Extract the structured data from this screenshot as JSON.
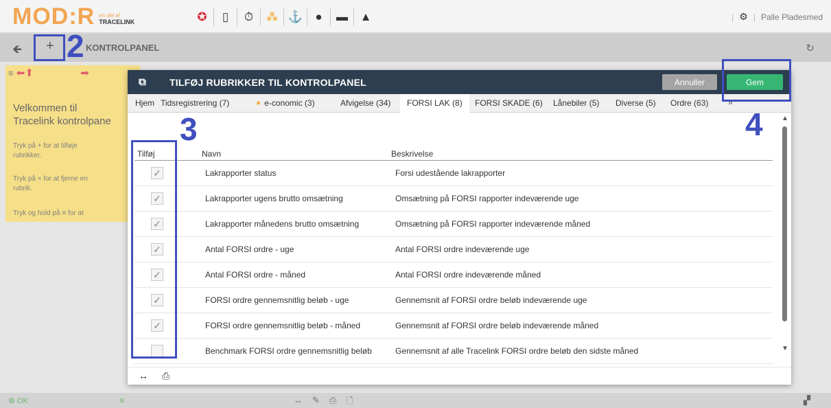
{
  "app": {
    "logo_main": "MOD:R",
    "logo_small": "en del af",
    "logo_trace": "TRACELINK",
    "user_name": "Palle Pladesmed"
  },
  "toolbar_icons": [
    "lifebuoy-icon",
    "mobile-icon",
    "timer-icon",
    "graph-icon",
    "anchor-icon",
    "chat-icon",
    "envelope-icon",
    "warning-icon"
  ],
  "nav": {
    "title": "KONTROLPANEL"
  },
  "welcome": {
    "title_line1": "Velkommen til",
    "title_line2": "Tracelink kontrolpane",
    "text1_line1": "Tryk på  +  for at tilføje",
    "text1_line2": "rubrikker.",
    "text2_line1": "Tryk på  ×  for at fjerne en",
    "text2_line2": "rubrik.",
    "text3_line1": "Tryk og hold på  ≡  for at"
  },
  "status": {
    "ok_label": "OK"
  },
  "modal": {
    "title": "TILFØJ RUBRIKKER TIL KONTROLPANEL",
    "cancel_label": "Annuller",
    "save_label": "Gem",
    "tabs": [
      {
        "label": "Hjem"
      },
      {
        "label": "Tidsregistrering (7)"
      },
      {
        "label": "e-conomic (3)"
      },
      {
        "label": "Afvigelse (34)"
      },
      {
        "label": "FORSI LAK (8)"
      },
      {
        "label": "FORSI SKADE (6)"
      },
      {
        "label": "Lånebiler (5)"
      },
      {
        "label": "Diverse (5)"
      },
      {
        "label": "Ordre (63)"
      }
    ],
    "tab_more": "»",
    "active_tab": "FORSI LAK (8)",
    "columns": {
      "add": "Tilføj",
      "name": "Navn",
      "description": "Beskrivelse"
    },
    "rows": [
      {
        "checked": true,
        "name": "Lakrapporter status",
        "description": "Forsi udestående lakrapporter"
      },
      {
        "checked": true,
        "name": "Lakrapporter ugens brutto omsætning",
        "description": "Omsætning på FORSI rapporter indeværende uge"
      },
      {
        "checked": true,
        "name": "Lakrapporter månedens brutto omsætning",
        "description": "Omsætning på FORSI rapporter indeværende måned"
      },
      {
        "checked": true,
        "name": "Antal FORSI ordre - uge",
        "description": "Antal FORSI ordre indeværende uge"
      },
      {
        "checked": true,
        "name": "Antal FORSI ordre - måned",
        "description": "Antal FORSI ordre indeværende måned"
      },
      {
        "checked": true,
        "name": "FORSI ordre gennemsnitlig beløb - uge",
        "description": "Gennemsnit af FORSI ordre beløb indeværende uge"
      },
      {
        "checked": true,
        "name": "FORSI ordre gennemsnitlig beløb - måned",
        "description": "Gennemsnit af FORSI ordre beløb indeværende måned"
      },
      {
        "checked": false,
        "name": "Benchmark FORSI ordre gennemsnitlig beløb",
        "description": "Gennemsnit af alle Tracelink FORSI ordre beløb den sidste måned"
      }
    ]
  },
  "annotations": {
    "n2": "2",
    "n3": "3",
    "n4": "4",
    "color": "#3f4fbf"
  }
}
